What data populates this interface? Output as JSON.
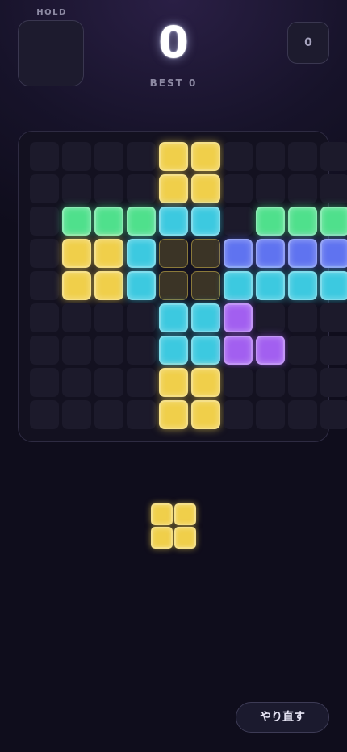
{
  "hold": {
    "label": "HOLD"
  },
  "score": {
    "value": "0",
    "best_text": "BEST 0"
  },
  "counter": {
    "value": "0"
  },
  "colors": {
    "G": "#4fe08c",
    "Y": "#f0cf4a",
    "C": "#3cc9e0",
    "B": "#5f73f0",
    "P": "#a25ff0"
  },
  "board": {
    "rows": [
      "....YY....",
      "....YY....",
      ".GGGCC.GGG",
      ".YYCggBBBB",
      ".YYCggCCCC",
      "....CCP...",
      "....CCPP..",
      "....YY....",
      "....YY...."
    ],
    "legend": {
      ".": "empty",
      "g": "ghost"
    }
  },
  "next_piece": {
    "color": "Y",
    "shape": [
      "YY",
      "YY"
    ]
  },
  "actions": {
    "retry_label": "やり直す"
  }
}
